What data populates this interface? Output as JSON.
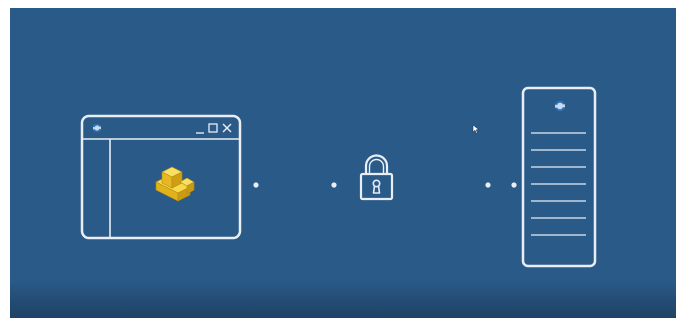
{
  "icons": {
    "client_app_icon": "app-logo-icon",
    "client_minimize": "minimize-icon",
    "client_maximize": "maximize-icon",
    "client_close": "close-icon",
    "client_content": "building-blocks-icon",
    "connection": "padlock-icon",
    "server_app_icon": "app-logo-icon",
    "cursor": "mouse-pointer-icon"
  },
  "colors": {
    "background": "#2a5a88",
    "outline": "#e8eef4",
    "blocks": "#f2c72e",
    "blocks_shadow": "#c99a12",
    "logo_blue": "#2f6fb8",
    "logo_light": "#c9dbef"
  }
}
